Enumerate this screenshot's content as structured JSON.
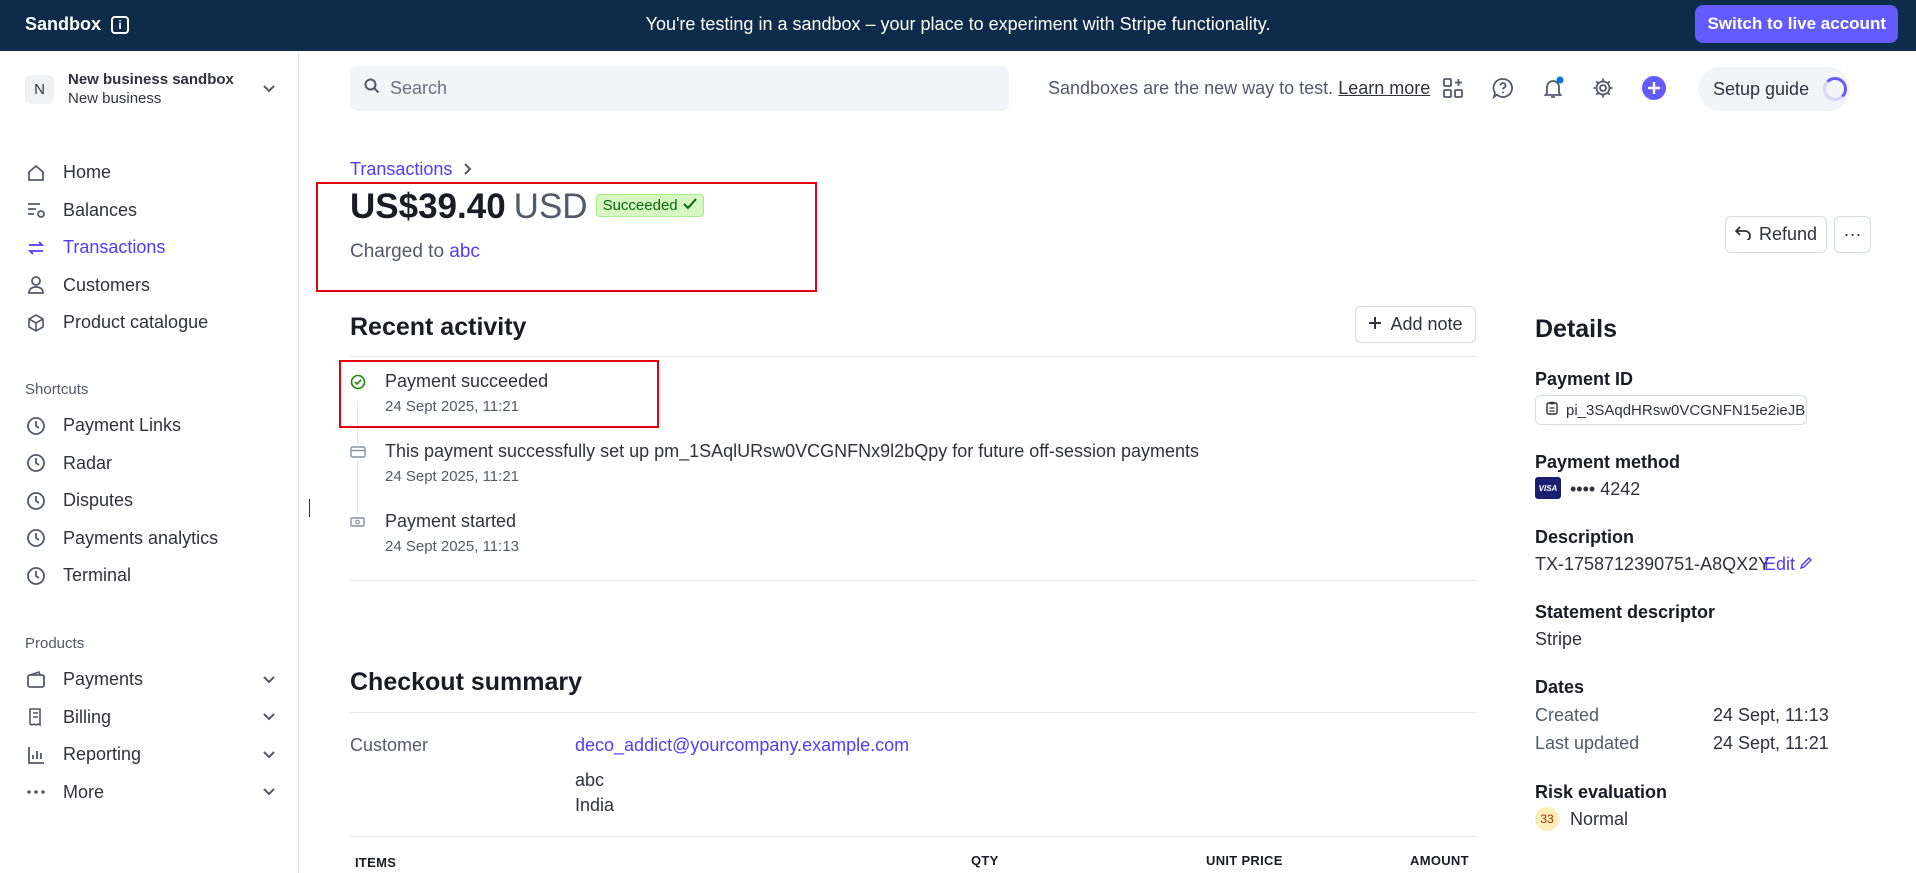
{
  "banner": {
    "sandbox_label": "Sandbox",
    "message": "You're testing in a sandbox – your place to experiment with Stripe functionality.",
    "live_button": "Switch to live account"
  },
  "account": {
    "initial": "N",
    "name": "New business sandbox",
    "sub": "New business"
  },
  "nav": {
    "main": [
      {
        "label": "Home",
        "icon": "home-icon"
      },
      {
        "label": "Balances",
        "icon": "balances-icon"
      },
      {
        "label": "Transactions",
        "icon": "transactions-icon",
        "active": true
      },
      {
        "label": "Customers",
        "icon": "customers-icon"
      },
      {
        "label": "Product catalogue",
        "icon": "product-icon"
      }
    ],
    "shortcuts_label": "Shortcuts",
    "shortcuts": [
      "Payment Links",
      "Radar",
      "Disputes",
      "Payments analytics",
      "Terminal"
    ],
    "products_label": "Products",
    "products": [
      "Payments",
      "Billing",
      "Reporting",
      "More"
    ]
  },
  "topbar": {
    "search_placeholder": "Search",
    "promo_text": "Sandboxes are the new way to test.",
    "promo_link": "Learn more",
    "setup_guide": "Setup guide"
  },
  "header": {
    "breadcrumb": "Transactions",
    "amount": "US$39.40",
    "currency": "USD",
    "status": "Succeeded",
    "charged_prefix": "Charged to",
    "charged_to": "abc",
    "refund": "Refund",
    "more": "···"
  },
  "activity": {
    "title": "Recent activity",
    "add_note": "Add note",
    "items": [
      {
        "title": "Payment succeeded",
        "time": "24 Sept 2025, 11:21"
      },
      {
        "title": "This payment successfully set up pm_1SAqlURsw0VCGNFNx9l2bQpy for future off-session payments",
        "time": "24 Sept 2025, 11:21"
      },
      {
        "title": "Payment started",
        "time": "24 Sept 2025, 11:13"
      }
    ]
  },
  "checkout": {
    "title": "Checkout summary",
    "customer_label": "Customer",
    "email": "deco_addict@yourcompany.example.com",
    "name": "abc",
    "country": "India",
    "columns": [
      "ITEMS",
      "QTY",
      "UNIT PRICE",
      "AMOUNT"
    ]
  },
  "details": {
    "title": "Details",
    "payment_id_label": "Payment ID",
    "payment_id": "pi_3SAqdHRsw0VCGNFN15e2ieJB",
    "payment_method_label": "Payment method",
    "card_brand": "VISA",
    "card_last4": "•••• 4242",
    "description_label": "Description",
    "description": "TX-1758712390751-A8QX2Y",
    "edit": "Edit",
    "statement_label": "Statement descriptor",
    "statement": "Stripe",
    "dates_label": "Dates",
    "created_label": "Created",
    "created": "24 Sept, 11:13",
    "updated_label": "Last updated",
    "updated": "24 Sept, 11:21",
    "risk_label": "Risk evaluation",
    "risk_score": "33",
    "risk_level": "Normal"
  }
}
